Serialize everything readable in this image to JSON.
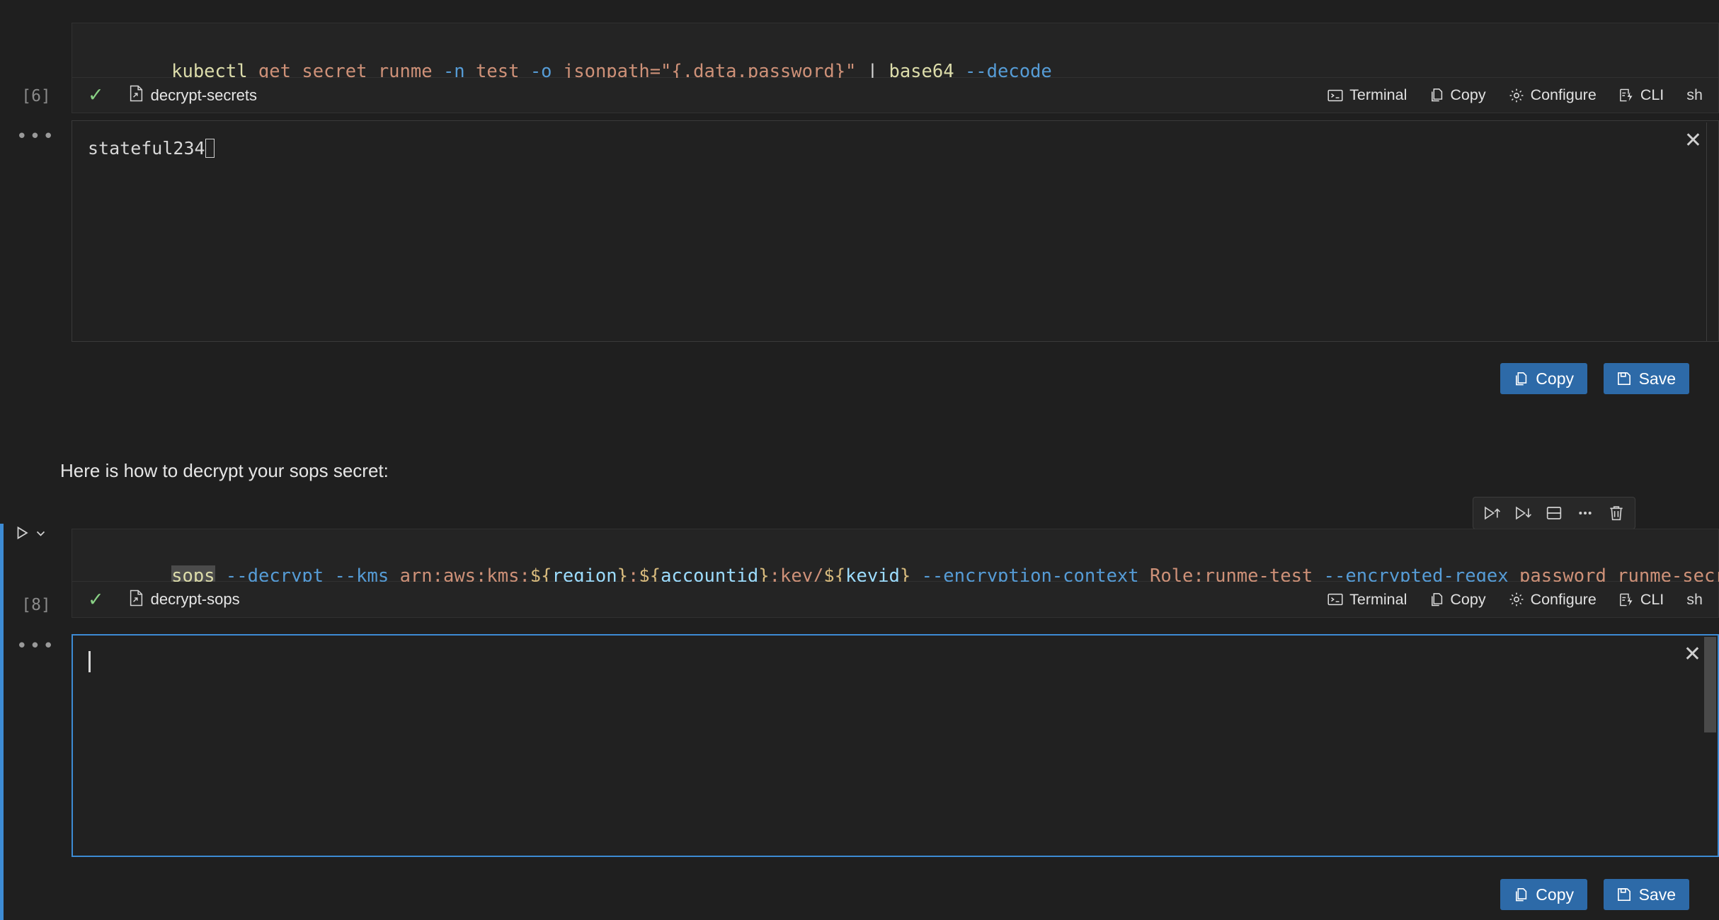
{
  "theme": {
    "background": "#1f1f1f",
    "cell_background": "#242424",
    "output_background": "#212121",
    "accent_blue": "#3d8bd4",
    "button_blue": "#2d6aa8",
    "success_green": "#89d185",
    "border": "#313131"
  },
  "cells": [
    {
      "id": "cell-decrypt-secrets",
      "execution_count": "[6]",
      "language": "sh",
      "code_tokens": [
        {
          "text": "kubectl",
          "type": "cmd"
        },
        {
          "text": " ",
          "type": "plain"
        },
        {
          "text": "get secret runme",
          "type": "arg"
        },
        {
          "text": " ",
          "type": "plain"
        },
        {
          "text": "-n",
          "type": "flag"
        },
        {
          "text": " ",
          "type": "plain"
        },
        {
          "text": "test",
          "type": "arg"
        },
        {
          "text": " ",
          "type": "plain"
        },
        {
          "text": "-o",
          "type": "flag"
        },
        {
          "text": " ",
          "type": "plain"
        },
        {
          "text": "jsonpath=\"{.data.password}\"",
          "type": "arg"
        },
        {
          "text": " ",
          "type": "plain"
        },
        {
          "text": "|",
          "type": "punct"
        },
        {
          "text": " ",
          "type": "plain"
        },
        {
          "text": "base64",
          "type": "cmd"
        },
        {
          "text": " ",
          "type": "plain"
        },
        {
          "text": "--decode",
          "type": "flag"
        }
      ],
      "code_plain": "kubectl get secret runme -n test -o jsonpath=\"{.data.password}\" | base64 --decode",
      "status": {
        "state_icon": "check-icon",
        "name": "decrypt-secrets",
        "name_icon": "script-file-icon"
      },
      "actions": [
        {
          "label": "Terminal",
          "icon": "terminal-icon"
        },
        {
          "label": "Copy",
          "icon": "copy-icon"
        },
        {
          "label": "Configure",
          "icon": "gear-icon"
        },
        {
          "label": "CLI",
          "icon": "cli-icon"
        }
      ],
      "language_label": "sh",
      "output": {
        "text": "stateful234",
        "cursor": "block",
        "focused": false,
        "close_label": "✕"
      },
      "output_buttons": [
        {
          "label": "Copy",
          "icon": "copy-icon"
        },
        {
          "label": "Save",
          "icon": "save-icon"
        }
      ]
    },
    {
      "id": "cell-decrypt-sops",
      "execution_count": "[8]",
      "language": "sh",
      "selected": true,
      "code_tokens": [
        {
          "text": "sops",
          "type": "cmd",
          "selected": true
        },
        {
          "text": " ",
          "type": "plain"
        },
        {
          "text": "--decrypt",
          "type": "flag"
        },
        {
          "text": " ",
          "type": "plain"
        },
        {
          "text": "--kms",
          "type": "flag"
        },
        {
          "text": " ",
          "type": "plain"
        },
        {
          "text": "arn:aws:kms:",
          "type": "arg"
        },
        {
          "text": "${",
          "type": "brace"
        },
        {
          "text": "region",
          "type": "var"
        },
        {
          "text": "}",
          "type": "brace"
        },
        {
          "text": ":",
          "type": "arg"
        },
        {
          "text": "${",
          "type": "brace"
        },
        {
          "text": "accountid",
          "type": "var"
        },
        {
          "text": "}",
          "type": "brace"
        },
        {
          "text": ":key/",
          "type": "arg"
        },
        {
          "text": "${",
          "type": "brace"
        },
        {
          "text": "keyid",
          "type": "var"
        },
        {
          "text": "}",
          "type": "brace"
        },
        {
          "text": " ",
          "type": "plain"
        },
        {
          "text": "--encryption-context",
          "type": "flag"
        },
        {
          "text": " ",
          "type": "plain"
        },
        {
          "text": "Role:runme-test",
          "type": "arg"
        },
        {
          "text": " ",
          "type": "plain"
        },
        {
          "text": "--encrypted-regex",
          "type": "flag"
        },
        {
          "text": " ",
          "type": "plain"
        },
        {
          "text": "password runme-secrets-enc.yaml",
          "type": "arg"
        }
      ],
      "code_plain": "sops --decrypt --kms arn:aws:kms:${region}:${accountid}:key/${keyid} --encryption-context Role:runme-test --encrypted-regex password runme-secrets-enc.yaml",
      "status": {
        "state_icon": "check-icon",
        "name": "decrypt-sops",
        "name_icon": "script-file-icon"
      },
      "actions": [
        {
          "label": "Terminal",
          "icon": "terminal-icon"
        },
        {
          "label": "Copy",
          "icon": "copy-icon"
        },
        {
          "label": "Configure",
          "icon": "gear-icon"
        },
        {
          "label": "CLI",
          "icon": "cli-icon"
        }
      ],
      "language_label": "sh",
      "output": {
        "text": "",
        "cursor": "ibeam",
        "focused": true,
        "close_label": "✕"
      },
      "output_buttons": [
        {
          "label": "Copy",
          "icon": "copy-icon"
        },
        {
          "label": "Save",
          "icon": "save-icon"
        }
      ],
      "toolbar": [
        {
          "icon": "run-above-icon",
          "title": "Execute Above Cells"
        },
        {
          "icon": "run-below-icon",
          "title": "Execute Cell and Below"
        },
        {
          "icon": "split-cell-icon",
          "title": "Split Cell"
        },
        {
          "icon": "more-actions-icon",
          "title": "More Actions"
        },
        {
          "icon": "delete-icon",
          "title": "Delete Cell"
        }
      ],
      "run_button": {
        "icon": "play-icon",
        "chevron": "chevron-down-icon"
      }
    }
  ],
  "markdown": {
    "text": "Here is how to decrypt your sops secret:"
  }
}
